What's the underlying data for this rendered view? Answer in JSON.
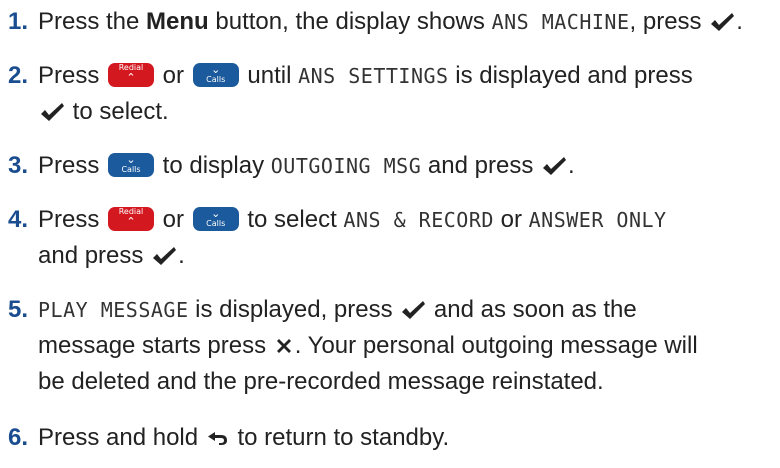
{
  "colors": {
    "number": "#1a4d8f",
    "redial_key": "#d31820",
    "calls_key": "#1b5a9c",
    "text": "#222222"
  },
  "keys": {
    "redial": "Redial",
    "calls": "Calls"
  },
  "icons": {
    "ok": "checkmark-icon",
    "cancel": "x-icon",
    "back": "back-arrow-icon"
  },
  "steps": [
    {
      "num": "1.",
      "a": "Press the ",
      "menu": "Menu",
      "b": " button, the display shows ",
      "lcd": "ANS MACHINE",
      "c": ", press ",
      "d": "."
    },
    {
      "num": "2.",
      "a": "Press ",
      "or": " or ",
      "b": " until ",
      "lcd": "ANS SETTINGS",
      "c": " is displayed and press",
      "d": " to select."
    },
    {
      "num": "3.",
      "a": "Press ",
      "b": " to display ",
      "lcd": "OUTGOING MSG",
      "c": " and press ",
      "d": "."
    },
    {
      "num": "4.",
      "a": "Press ",
      "or": " or ",
      "b": " to select ",
      "lcd1": "ANS & RECORD",
      "c": " or ",
      "lcd2": "ANSWER ONLY",
      "d": "and press ",
      "e": "."
    },
    {
      "num": "5.",
      "lcd": "PLAY MESSAGE",
      "a": " is displayed, press ",
      "b": " and as soon as the",
      "c": "message starts press ",
      "d": ". Your personal outgoing message will",
      "e": "be deleted and the pre-recorded message reinstated."
    },
    {
      "num": "6.",
      "a": "Press and hold ",
      "b": " to return to standby."
    }
  ]
}
